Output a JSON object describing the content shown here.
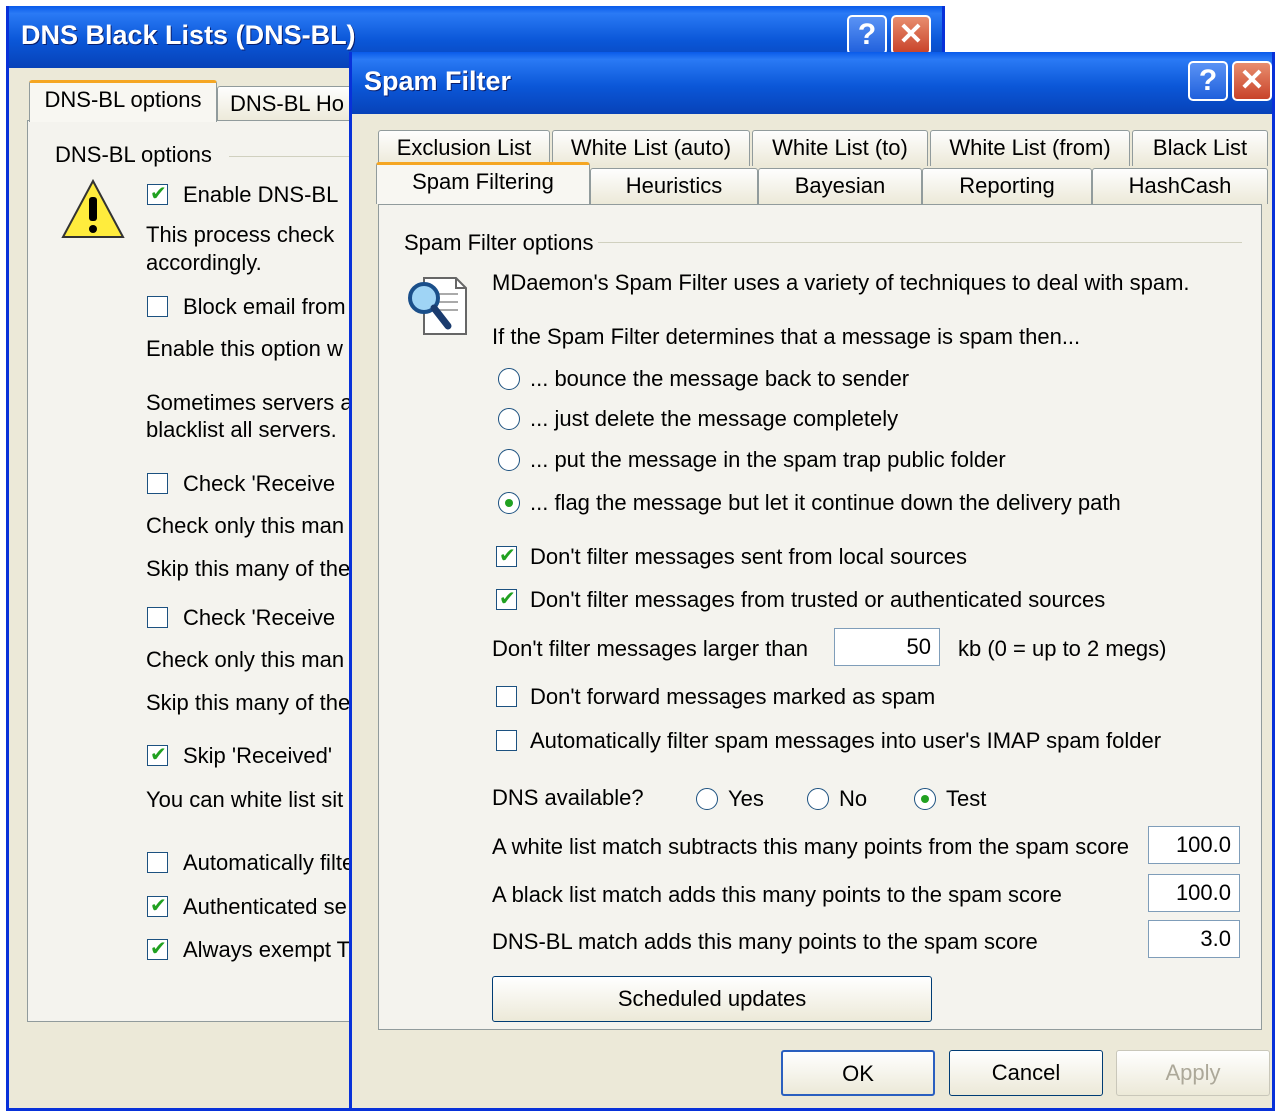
{
  "dnsbl": {
    "title": "DNS Black Lists (DNS-BL)",
    "tabs": [
      "DNS-BL options",
      "DNS-BL Ho"
    ],
    "group": "DNS-BL options",
    "items": [
      "Enable DNS-BL",
      "This process check",
      "accordingly.",
      "Block email from",
      "Enable this option w",
      "Sometimes servers a",
      "blacklist all servers.",
      "Check 'Receive",
      "Check only this man",
      "Skip this many of the",
      "Check 'Receive",
      "Check only this man",
      "Skip this many of the",
      "Skip 'Received'",
      "You can white list sit",
      "Automatically filte",
      "Authenticated se",
      "Always exempt T"
    ]
  },
  "spam": {
    "title": "Spam Filter",
    "tabs_row1": [
      "Exclusion List",
      "White List (auto)",
      "White List (to)",
      "White List (from)",
      "Black List"
    ],
    "tabs_row2": [
      "Spam Filtering",
      "Heuristics",
      "Bayesian",
      "Reporting",
      "HashCash"
    ],
    "group": "Spam Filter options",
    "intro": "MDaemon's Spam Filter uses a variety of techniques to deal with spam.",
    "question": "If the Spam Filter determines that a message is spam then...",
    "radios": [
      "... bounce the message back to sender",
      "... just delete the message completely",
      "... put the message in the spam trap public folder",
      "... flag the message but let it continue down the delivery path"
    ],
    "chk_local": "Don't filter messages sent from local sources",
    "chk_trusted": "Don't filter messages from trusted or authenticated sources",
    "size_label": "Don't filter messages larger than",
    "size_value": "50",
    "size_unit": "kb (0 = up to 2 megs)",
    "chk_forward": "Don't forward messages marked as spam",
    "chk_imap": "Automatically filter spam messages into user's IMAP spam folder",
    "dns_label": "DNS available?",
    "dns_opts": [
      "Yes",
      "No",
      "Test"
    ],
    "white_label": "A white list match subtracts this many points from the spam score",
    "white_value": "100.0",
    "black_label": "A black list match adds this many points to the spam score",
    "black_value": "100.0",
    "dnsbl_label": "DNS-BL match adds this many points to the spam score",
    "dnsbl_value": "3.0",
    "scheduled": "Scheduled updates",
    "ok": "OK",
    "cancel": "Cancel",
    "apply": "Apply"
  }
}
